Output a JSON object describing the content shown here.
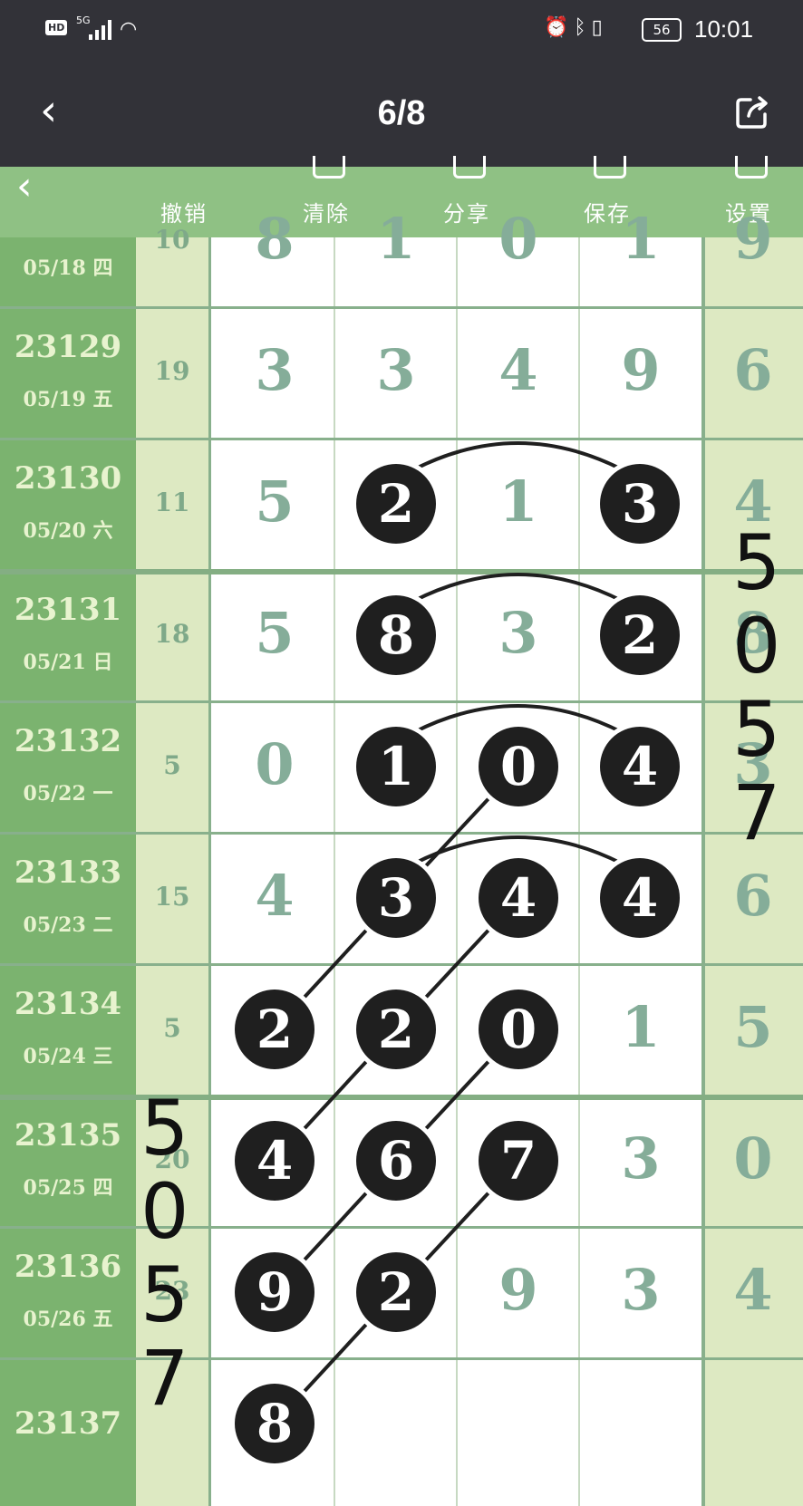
{
  "status_bar": {
    "hd_badge": "HD",
    "signal_label": "5G",
    "battery": "56",
    "time": "10:01",
    "icons": [
      "alarm-icon",
      "bluetooth-icon",
      "vibrate-icon"
    ]
  },
  "header": {
    "title": "6/8"
  },
  "toolbar": {
    "items": [
      {
        "label": "撤销",
        "icon": "undo-icon"
      },
      {
        "label": "清除",
        "icon": "clear-icon"
      },
      {
        "label": "分享",
        "icon": "share-icon"
      },
      {
        "label": "保存",
        "icon": "save-icon"
      },
      {
        "label": "设置",
        "icon": "settings-icon"
      }
    ]
  },
  "rows": [
    {
      "issue": "",
      "date": "05/18 四",
      "sum": "10",
      "digits": [
        "8",
        "1",
        "0",
        "1"
      ],
      "right": "9"
    },
    {
      "issue": "23129",
      "date": "05/19 五",
      "sum": "19",
      "digits": [
        "3",
        "3",
        "4",
        "9"
      ],
      "right": "6"
    },
    {
      "issue": "23130",
      "date": "05/20 六",
      "sum": "11",
      "digits": [
        "5",
        "2",
        "1",
        "3"
      ],
      "right": "4"
    },
    {
      "issue": "23131",
      "date": "05/21 日",
      "sum": "18",
      "digits": [
        "5",
        "8",
        "3",
        "2"
      ],
      "right": "8"
    },
    {
      "issue": "23132",
      "date": "05/22 一",
      "sum": "5",
      "digits": [
        "0",
        "1",
        "0",
        "4"
      ],
      "right": "3"
    },
    {
      "issue": "23133",
      "date": "05/23 二",
      "sum": "15",
      "digits": [
        "4",
        "3",
        "4",
        "4"
      ],
      "right": "6"
    },
    {
      "issue": "23134",
      "date": "05/24 三",
      "sum": "5",
      "digits": [
        "2",
        "2",
        "0",
        "1"
      ],
      "right": "5"
    },
    {
      "issue": "23135",
      "date": "05/25 四",
      "sum": "20",
      "digits": [
        "4",
        "6",
        "7",
        "3"
      ],
      "right": "0"
    },
    {
      "issue": "23136",
      "date": "05/26 五",
      "sum": "23",
      "digits": [
        "9",
        "2",
        "9",
        "3"
      ],
      "right": "4"
    },
    {
      "issue": "23137",
      "date": "",
      "sum": "",
      "digits": [
        "8",
        "",
        "",
        ""
      ],
      "right": ""
    }
  ],
  "highlights": [
    {
      "row": 2,
      "col": 1
    },
    {
      "row": 2,
      "col": 3
    },
    {
      "row": 3,
      "col": 1
    },
    {
      "row": 3,
      "col": 3
    },
    {
      "row": 4,
      "col": 1
    },
    {
      "row": 4,
      "col": 2
    },
    {
      "row": 4,
      "col": 3
    },
    {
      "row": 5,
      "col": 1
    },
    {
      "row": 5,
      "col": 2
    },
    {
      "row": 5,
      "col": 3
    },
    {
      "row": 6,
      "col": 0
    },
    {
      "row": 6,
      "col": 1
    },
    {
      "row": 6,
      "col": 2
    },
    {
      "row": 7,
      "col": 0
    },
    {
      "row": 7,
      "col": 1
    },
    {
      "row": 7,
      "col": 2
    },
    {
      "row": 8,
      "col": 0
    },
    {
      "row": 8,
      "col": 1
    },
    {
      "row": 9,
      "col": 0
    }
  ],
  "annotations": {
    "right_handwriting": "5057",
    "left_handwriting": "5057"
  }
}
